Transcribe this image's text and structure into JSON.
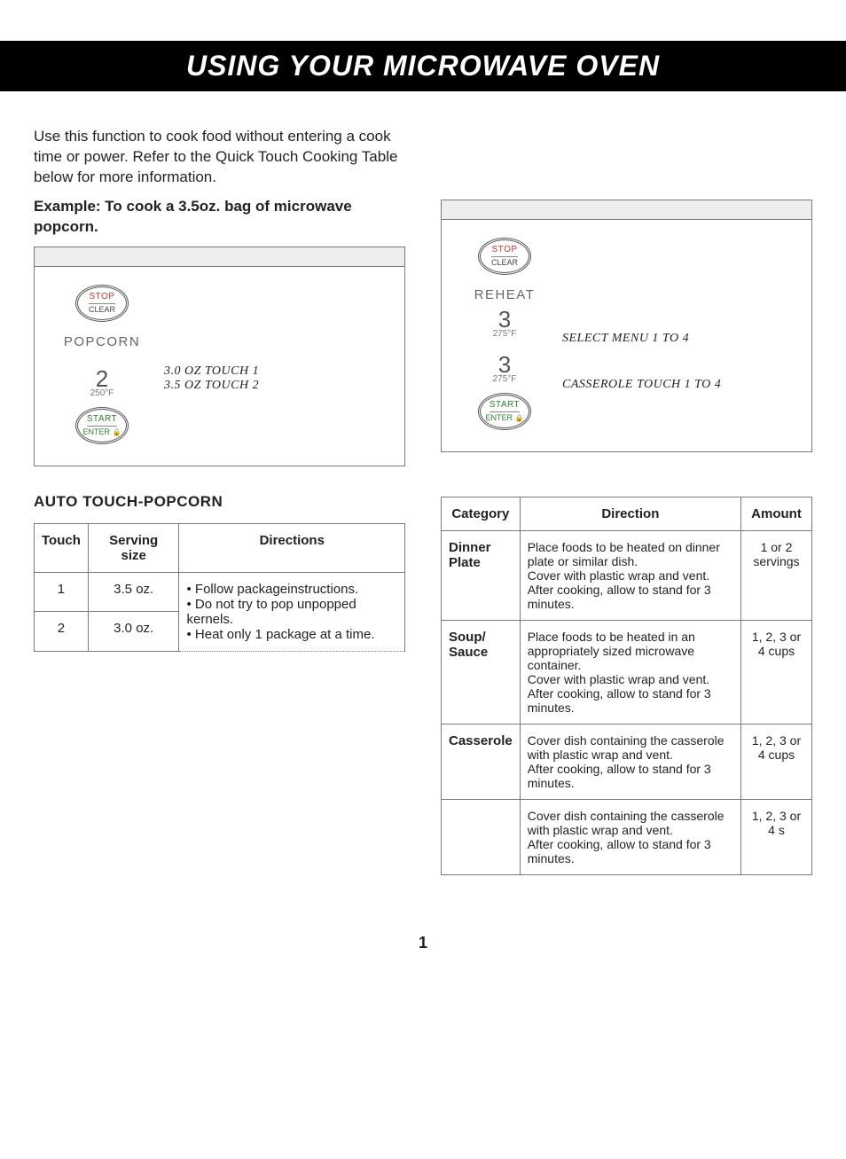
{
  "banner": "USING YOUR MICROWAVE OVEN",
  "intro": "Use this function to cook food without entering a cook time or power. Refer to the Quick Touch Cooking Table below for more information.",
  "example_heading": "Example: To cook a 3.5oz. bag of microwave popcorn.",
  "buttons": {
    "stop_top": "STOP",
    "stop_bottom": "CLEAR",
    "start_top": "START",
    "start_bottom": "ENTER"
  },
  "left_panel": {
    "key": "POPCORN",
    "display_line1": "3.0 OZ TOUCH 1",
    "display_line2": "3.5 OZ TOUCH 2",
    "num": "2",
    "temp": "250°F"
  },
  "section_left": "AUTO TOUCH-POPCORN",
  "popcorn_table": {
    "headers": {
      "touch": "Touch",
      "serving": "Serving size",
      "directions": "Directions"
    },
    "rows": [
      {
        "touch": "1",
        "serving": "3.5 oz."
      },
      {
        "touch": "2",
        "serving": "3.0 oz."
      }
    ],
    "directions": "• Follow packagein­structions.\n• Do not try to pop unpopped kernels.\n• Heat only 1 package at a time."
  },
  "right_panel": {
    "key": "REHEAT",
    "display_line1": "SELECT MENU 1 TO 4",
    "display_line2": "CASSEROLE TOUCH 1 TO 4",
    "num1": "3",
    "temp1": "275°F",
    "num2": "3",
    "temp2": "275°F"
  },
  "reheat_table": {
    "headers": {
      "category": "Category",
      "direction": "Direction",
      "amount": "Amount"
    },
    "rows": [
      {
        "category": "Dinner Plate",
        "direction": "Place foods to be heated on dinner plate or similar dish.\nCover with plastic wrap and vent.\nAfter cooking, allow to stand for 3 minutes.",
        "amount": "1 or 2 servings"
      },
      {
        "category": "Soup/ Sauce",
        "direction": "Place foods to be heated in an appropriately sized microwave container.\nCover with plastic wrap and vent.\nAfter cooking, allow to stand for 3 minutes.",
        "amount": "1, 2, 3 or 4 cups"
      },
      {
        "category": "Casserole",
        "direction": "Cover dish containing the casserole with plastic wrap and vent.\nAfter cooking, allow to stand for 3 minutes.",
        "amount": "1, 2, 3 or 4 cups"
      },
      {
        "category": "",
        "direction": "Cover dish containing the casserole with plastic wrap and vent.\nAfter cooking, allow to stand for 3 minutes.",
        "amount": "1, 2, 3 or 4 s"
      }
    ]
  },
  "pagenum": "1"
}
